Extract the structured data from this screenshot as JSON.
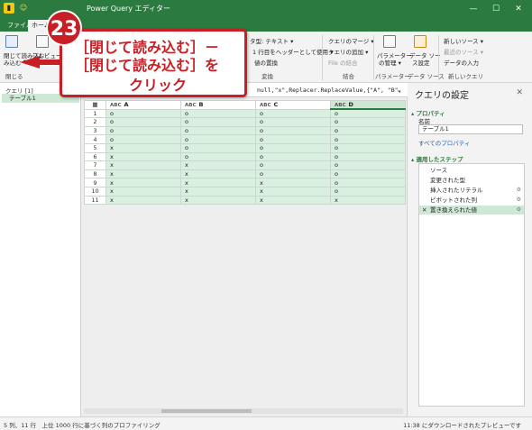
{
  "titlebar": {
    "title": "Power Query エディター",
    "smile": "☺",
    "minimize": "—",
    "maximize": "☐",
    "close": "✕"
  },
  "tabs": [
    "ファイル",
    "ホーム"
  ],
  "ribbon": {
    "close_load": "閉じて読み込む",
    "close_load_2": "み込む",
    "close_load_3": "▾",
    "preview": "プレビュー",
    "close_group": "閉じる",
    "datatype": "タ型: テキスト ▾",
    "first_row": "1 行目をヘッダーとして使用 ▾",
    "replace": "値の置換",
    "transform_group": "変換",
    "merge": "クエリのマージ ▾",
    "append": "クエリの追加 ▾",
    "file_merge": "File の結合",
    "combine_group": "結合",
    "params": "パラメーター",
    "params_2": "の管理 ▾",
    "params_group": "パラメーター",
    "datasource": "データ ソー",
    "datasource_2": "ス設定",
    "datasource_group": "データ ソース",
    "new_source": "新しいソース ▾",
    "recent_source": "最近のソース ▾",
    "enter_data": "データの入力",
    "newquery_group": "新しいクエリ"
  },
  "queries": {
    "header": "クエリ [1]",
    "item": "テーブル1"
  },
  "formula": {
    "text": "null,\"x\",Replacer.ReplaceValue,{\"A\", \"B\",",
    "chevron": "⌄"
  },
  "grid": {
    "corner": "▦",
    "type_icon": "ABC",
    "columns": [
      "A",
      "B",
      "C",
      "D"
    ],
    "rows": [
      [
        "1",
        "o",
        "o",
        "o",
        "o"
      ],
      [
        "2",
        "o",
        "o",
        "o",
        "o"
      ],
      [
        "3",
        "o",
        "o",
        "o",
        "o"
      ],
      [
        "4",
        "o",
        "o",
        "o",
        "o"
      ],
      [
        "5",
        "x",
        "o",
        "o",
        "o"
      ],
      [
        "6",
        "x",
        "o",
        "o",
        "o"
      ],
      [
        "7",
        "x",
        "x",
        "o",
        "o"
      ],
      [
        "8",
        "x",
        "x",
        "o",
        "o"
      ],
      [
        "9",
        "x",
        "x",
        "x",
        "o"
      ],
      [
        "10",
        "x",
        "x",
        "x",
        "o"
      ],
      [
        "11",
        "x",
        "x",
        "x",
        "x"
      ]
    ]
  },
  "settings": {
    "title": "クエリの設定",
    "close": "✕",
    "props_header": "プロパティ",
    "name_label": "名前",
    "name_value": "テーブル1",
    "all_props": "すべてのプロパティ",
    "steps_header": "適用したステップ",
    "steps": [
      "ソース",
      "変更された型",
      "挿入されたリテラル",
      "ピボットされた列",
      "置き換えられた値"
    ],
    "gear": "⚙",
    "x": "✕"
  },
  "status": {
    "left": "5 列、11 行　上位 1000 行に基づく列のプロファイリング",
    "right": "11:38 にダウンロードされたプレビューです"
  },
  "callout": {
    "badge": "23",
    "line1": "［閉じて読み込む］－",
    "line2": "［閉じて読み込む］を",
    "line3": "クリック"
  },
  "colors": {
    "accent": "#2b7a3f",
    "annotation": "#c81e25",
    "cell": "#d9efe0"
  }
}
